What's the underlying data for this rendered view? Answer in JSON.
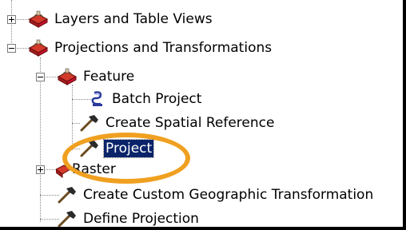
{
  "tree": {
    "items": [
      {
        "label": "Layers and Table Views",
        "icon": "toolbox-icon",
        "expander": "plus",
        "selected": false
      },
      {
        "label": "Projections and Transformations",
        "icon": "toolbox-icon",
        "expander": "minus",
        "selected": false
      },
      {
        "label": "Feature",
        "icon": "toolbox-icon",
        "expander": "minus",
        "selected": false
      },
      {
        "label": "Batch Project",
        "icon": "script-icon",
        "expander": "none",
        "selected": false
      },
      {
        "label": "Create Spatial Reference",
        "icon": "hammer-icon",
        "expander": "none",
        "selected": false
      },
      {
        "label": "Project",
        "icon": "hammer-icon",
        "expander": "none",
        "selected": true
      },
      {
        "label": "Raster",
        "icon": "toolbox-icon",
        "expander": "plus",
        "selected": false
      },
      {
        "label": "Create Custom Geographic Transformation",
        "icon": "hammer-icon",
        "expander": "none",
        "selected": false
      },
      {
        "label": "Define Projection",
        "icon": "hammer-icon",
        "expander": "none",
        "selected": false
      }
    ]
  },
  "annotation": {
    "color": "#f0a020",
    "target": "Project"
  },
  "colors": {
    "selection": "#0a246a",
    "toolbox_red": "#c8102e"
  }
}
